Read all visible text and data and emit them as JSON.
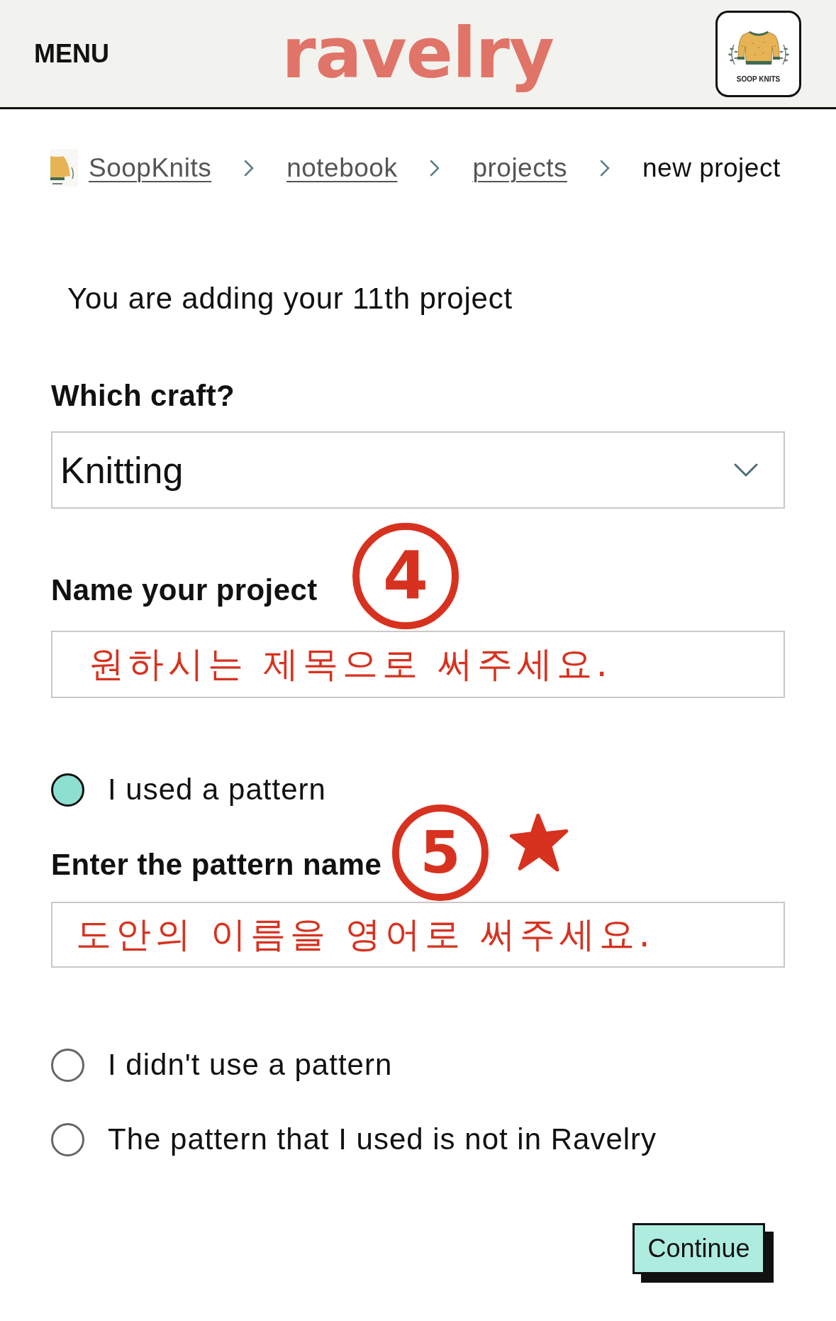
{
  "header": {
    "menu": "MENU",
    "logo": "ravelry",
    "avatar_caption": "SOOP KNITS"
  },
  "breadcrumb": [
    {
      "label": "SoopKnits",
      "kind": "user"
    },
    {
      "label": "notebook",
      "kind": "link"
    },
    {
      "label": "projects",
      "kind": "link"
    },
    {
      "label": "new project",
      "kind": "current"
    }
  ],
  "intro": "You are adding your 11th project",
  "craft": {
    "label": "Which craft?",
    "value": "Knitting"
  },
  "name_field": {
    "label": "Name your project",
    "step": "4",
    "note": "원하시는 제목으로 써주세요."
  },
  "pattern_options": [
    {
      "label": "I used a pattern",
      "selected": true,
      "field": {
        "label": "Enter the pattern name",
        "step": "5",
        "starred": true,
        "note": "도안의 이름을 영어로 써주세요."
      }
    },
    {
      "label": "I didn't use a pattern",
      "selected": false
    },
    {
      "label": "The pattern that I used is not in Ravelry",
      "selected": false
    }
  ],
  "continue_button": "Continue"
}
